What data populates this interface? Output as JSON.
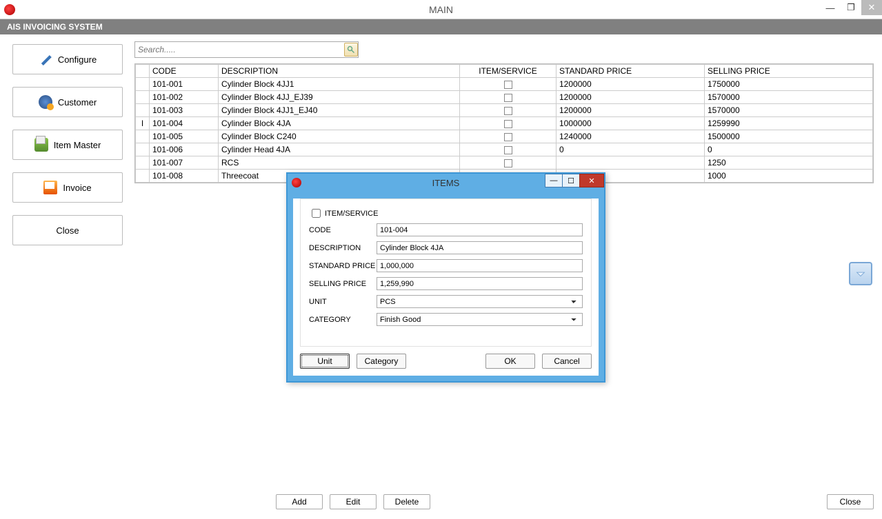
{
  "window": {
    "title": "MAIN"
  },
  "subheader": "AIS INVOICING SYSTEM",
  "sidebar": {
    "configure": "Configure",
    "customer": "Customer",
    "itemmaster": "Item Master",
    "invoice": "Invoice",
    "close": "Close"
  },
  "search": {
    "placeholder": "Search....."
  },
  "grid": {
    "headers": {
      "code": "CODE",
      "desc": "DESCRIPTION",
      "itemsvc": "ITEM/SERVICE",
      "std": "STANDARD PRICE",
      "sell": "SELLING PRICE"
    },
    "rows": [
      {
        "code": "101-001",
        "desc": "Cylinder Block 4JJ1",
        "std": "1200000",
        "sell": "1750000"
      },
      {
        "code": "101-002",
        "desc": "Cylinder Block 4JJ_EJ39",
        "std": "1200000",
        "sell": "1570000"
      },
      {
        "code": "101-003",
        "desc": "Cylinder Block 4JJ1_EJ40",
        "std": "1200000",
        "sell": "1570000"
      },
      {
        "code": "101-004",
        "desc": "Cylinder Block 4JA",
        "std": "1000000",
        "sell": "1259990",
        "cursor": true
      },
      {
        "code": "101-005",
        "desc": "Cylinder Block C240",
        "std": "1240000",
        "sell": "1500000"
      },
      {
        "code": "101-006",
        "desc": "Cylinder Head 4JA",
        "std": "0",
        "sell": "0"
      },
      {
        "code": "101-007",
        "desc": "RCS",
        "std": "",
        "sell": "1250"
      },
      {
        "code": "101-008",
        "desc": "Threecoat",
        "std": "",
        "sell": "1000"
      }
    ]
  },
  "bottom": {
    "add": "Add",
    "edit": "Edit",
    "delete": "Delete",
    "close": "Close"
  },
  "modal": {
    "title": "ITEMS",
    "labels": {
      "itemsvc": "ITEM/SERVICE",
      "code": "CODE",
      "desc": "DESCRIPTION",
      "std": "STANDARD PRICE",
      "sell": "SELLING PRICE",
      "unit": "UNIT",
      "category": "CATEGORY"
    },
    "values": {
      "code": "101-004",
      "desc": "Cylinder Block 4JA",
      "std": "1,000,000",
      "sell": "1,259,990",
      "unit": "PCS",
      "category": "Finish Good"
    },
    "buttons": {
      "unit": "Unit",
      "category": "Category",
      "ok": "OK",
      "cancel": "Cancel"
    }
  }
}
